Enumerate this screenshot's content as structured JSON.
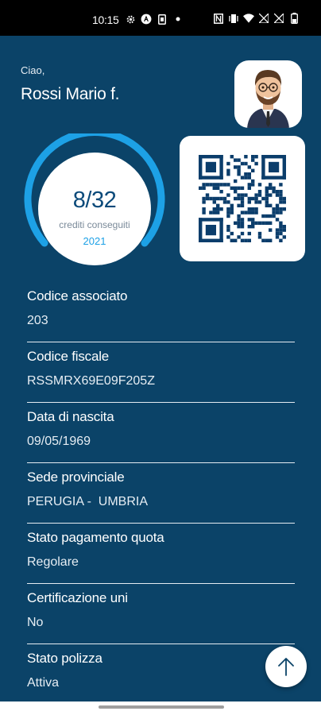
{
  "status_bar": {
    "time": "10:15",
    "icons_left": [
      "settings-icon",
      "accessibility-icon",
      "sim-icon",
      "dot-icon"
    ],
    "icons_right": [
      "nfc-icon",
      "vibrate-icon",
      "wifi-icon",
      "signal-icon",
      "signal-icon-2",
      "battery-icon"
    ]
  },
  "header": {
    "greeting": "Ciao,",
    "user_name": "Rossi Mario f."
  },
  "credits": {
    "count": "8/32",
    "label": "crediti conseguiti",
    "year": "2021",
    "progress_fraction": 0.25,
    "ring_color": "#1da1e6"
  },
  "qr": {
    "icon": "qr-code-icon"
  },
  "info": [
    {
      "label": "Codice associato",
      "value": "203"
    },
    {
      "label": "Codice fiscale",
      "value": "RSSMRX69E09F205Z"
    },
    {
      "label": "Data di nascita",
      "value": "09/05/1969"
    },
    {
      "label": "Sede provinciale",
      "value": "PERUGIA -  UMBRIA"
    },
    {
      "label": "Stato pagamento quota",
      "value": "Regolare"
    },
    {
      "label": "Certificazione uni",
      "value": "No"
    },
    {
      "label": "Stato polizza",
      "value": "Attiva"
    }
  ],
  "colors": {
    "background": "#0b4368",
    "accent": "#1da1e6"
  }
}
